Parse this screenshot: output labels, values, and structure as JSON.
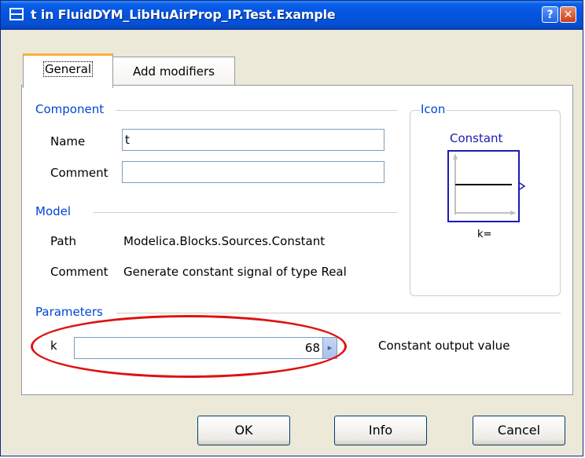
{
  "window": {
    "title": "t in FluidDYM_LibHuAirProp_IP.Test.Example",
    "help_label": "?",
    "close_label": "✕"
  },
  "tabs": [
    {
      "label": "General",
      "active": true
    },
    {
      "label": "Add modifiers",
      "active": false
    }
  ],
  "component": {
    "group_label": "Component",
    "name_label": "Name",
    "name_value": "t",
    "comment_label": "Comment",
    "comment_value": ""
  },
  "model": {
    "group_label": "Model",
    "path_label": "Path",
    "path_value": "Modelica.Blocks.Sources.Constant",
    "comment_label": "Comment",
    "comment_value": "Generate constant signal of type Real"
  },
  "icon": {
    "group_label": "Icon",
    "block_title": "Constant",
    "block_caption": "k="
  },
  "parameters": {
    "group_label": "Parameters",
    "k_label": "k",
    "k_value": "68",
    "k_description": "Constant output value",
    "spin_icon": "▸"
  },
  "buttons": {
    "ok": "OK",
    "info": "Info",
    "cancel": "Cancel"
  },
  "colors": {
    "title_bar": "#0454e0",
    "group_label": "#0046d5",
    "highlight_ellipse": "#e01010",
    "block_border": "#1a1ab8"
  }
}
